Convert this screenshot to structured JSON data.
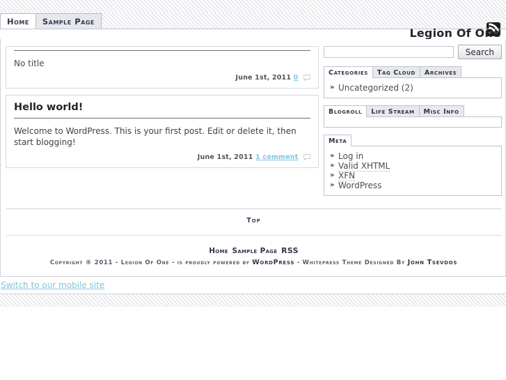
{
  "header": {
    "site_title": "Legion Of One",
    "rss_icon": "rss-icon",
    "nav": [
      {
        "label": "Home",
        "active": true
      },
      {
        "label": "Sample Page",
        "active": false
      }
    ]
  },
  "posts": [
    {
      "title": "No title",
      "untitled": true,
      "body": "",
      "date": "June 1st, 2011",
      "comments_label": "0",
      "comment_icon": "comment-bubble-icon"
    },
    {
      "title": "Hello world!",
      "untitled": false,
      "body": "Welcome to WordPress. This is your first post. Edit or delete it, then start blogging!",
      "date": "June 1st, 2011",
      "comments_label": "1 comment",
      "comment_icon": "comment-bubble-icon"
    }
  ],
  "sidebar": {
    "search": {
      "value": "",
      "placeholder": "",
      "button_label": "Search"
    },
    "widgets": [
      {
        "name": "categories-widget",
        "tabs": [
          {
            "label": "Categories",
            "active": true
          },
          {
            "label": "Tag Cloud",
            "active": false
          },
          {
            "label": "Archives",
            "active": false
          }
        ],
        "items": [
          {
            "label": "Uncategorized (2)",
            "dotted": false
          }
        ]
      },
      {
        "name": "blogroll-widget",
        "tabs": [
          {
            "label": "Blogroll",
            "active": true
          },
          {
            "label": "Life Stream",
            "active": false
          },
          {
            "label": "Misc Info",
            "active": false
          }
        ],
        "items": []
      },
      {
        "name": "meta-widget",
        "tabs": [
          {
            "label": "Meta",
            "active": true
          }
        ],
        "items": [
          {
            "label": "Log in",
            "dotted": false
          },
          {
            "label": "Valid XHTML",
            "dotted": true
          },
          {
            "label": "XFN",
            "dotted": true
          },
          {
            "label": "WordPress",
            "dotted": false
          }
        ]
      }
    ],
    "bullet": "»"
  },
  "footer": {
    "top_link": "Top",
    "nav": [
      {
        "label": "Home",
        "rss": false
      },
      {
        "label": "Sample Page",
        "rss": false
      },
      {
        "label": "RSS",
        "rss": true
      }
    ],
    "copyright_prefix": "Copyright ® 2011 - Legion Of One - is proudly powered by ",
    "copyright_wordpress": "WordPress",
    "copyright_middle": " - Whitepress Theme Designed By ",
    "copyright_author": "John Tsevdos"
  },
  "mobile": {
    "link_label": "Switch to our mobile site"
  },
  "colors": {
    "link": "#7fc4e0",
    "text": "#3f4149",
    "heading": "#23252c",
    "border": "#c0c2c9"
  }
}
